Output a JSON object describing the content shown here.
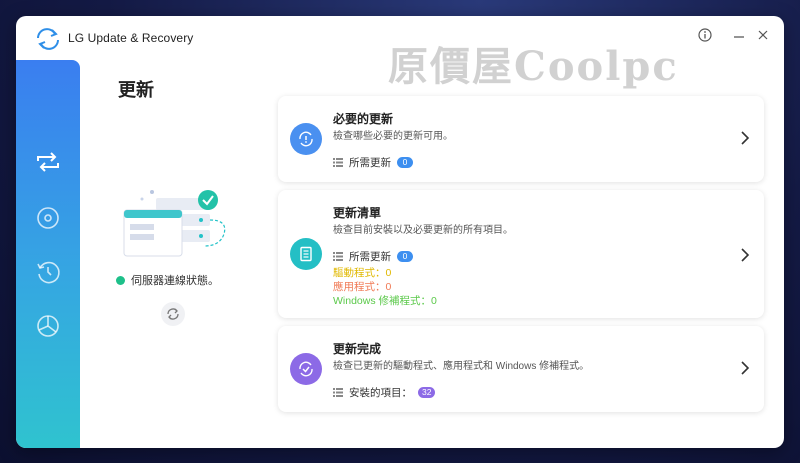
{
  "window": {
    "title": "LG Update & Recovery",
    "watermark": "原價屋Coolpc"
  },
  "nav": {
    "items": [
      {
        "id": "update",
        "icon": "sync-update-icon",
        "active": true
      },
      {
        "id": "recovery",
        "icon": "disc-recovery-icon"
      },
      {
        "id": "history",
        "icon": "history-clock-icon"
      },
      {
        "id": "dashboard",
        "icon": "pie-chart-icon"
      }
    ]
  },
  "main": {
    "page_title": "更新",
    "server_status": "伺服器連線狀態。"
  },
  "cards": {
    "required": {
      "title": "必要的更新",
      "desc": "檢查哪些必要的更新可用。",
      "count_label": "所需更新",
      "count": "0"
    },
    "list": {
      "title": "更新清單",
      "desc": "檢查目前安裝以及必要更新的所有項目。",
      "count_label": "所需更新",
      "count": "0",
      "drivers": "驅動程式：0",
      "apps": "應用程式：0",
      "windows": "Windows 修補程式：0"
    },
    "completed": {
      "title": "更新完成",
      "desc": "檢查已更新的驅動程式、應用程式和 Windows 修補程式。",
      "count_label": "安裝的項目：",
      "count": "32"
    }
  },
  "colors": {
    "accent_blue": "#3d8ff0",
    "teal": "#24bfc5",
    "purple": "#8c6ae6",
    "status_green": "#1ec08a",
    "drivers_color": "#e0b800",
    "apps_color": "#f07a55",
    "windows_color": "#5bc94a"
  }
}
